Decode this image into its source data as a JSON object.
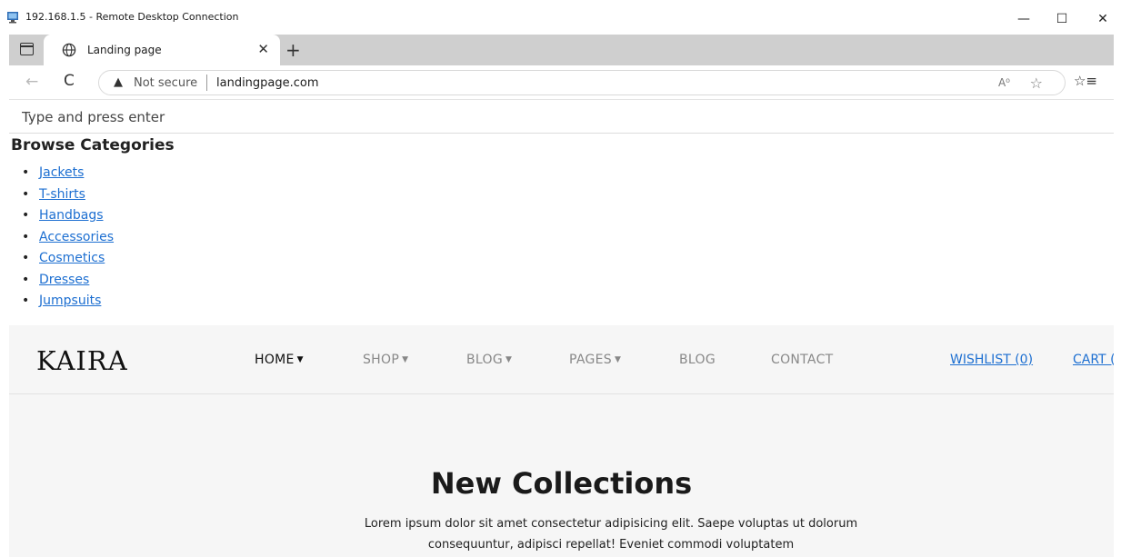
{
  "window": {
    "title": "192.168.1.5 - Remote Desktop Connection",
    "minimize": "—",
    "maximize": "☐",
    "close": "✕"
  },
  "browser": {
    "tab_title": "Landing page",
    "tab_close": "✕",
    "new_tab": "+",
    "back": "←",
    "reload": "C",
    "security_label": "Not secure",
    "url": "landingpage.com",
    "read_aloud": "A⁰",
    "favorite": "☆",
    "favorites_bar": "☆≡"
  },
  "page": {
    "search_placeholder": "Type and press enter",
    "browse_title": "Browse Categories",
    "categories": [
      {
        "label": "Jackets"
      },
      {
        "label": "T-shirts"
      },
      {
        "label": "Handbags"
      },
      {
        "label": "Accessories"
      },
      {
        "label": "Cosmetics"
      },
      {
        "label": "Dresses"
      },
      {
        "label": "Jumpsuits"
      }
    ],
    "logo": "KAIRA",
    "nav": {
      "home": "HOME",
      "shop": "SHOP",
      "blog_dropdown": "BLOG",
      "pages": "PAGES",
      "blog": "BLOG",
      "contact": "CONTACT",
      "wishlist": "WISHLIST (0)",
      "cart": "CART ("
    },
    "hero_title": "New Collections",
    "hero_text": "Lorem ipsum dolor sit amet consectetur adipisicing elit. Saepe voluptas ut dolorum consequuntur, adipisci repellat! Eveniet commodi voluptatem"
  },
  "colors": {
    "link": "#1d6fd1",
    "tab_strip": "#cfcfcf",
    "hero_bg": "#f6f6f6"
  }
}
